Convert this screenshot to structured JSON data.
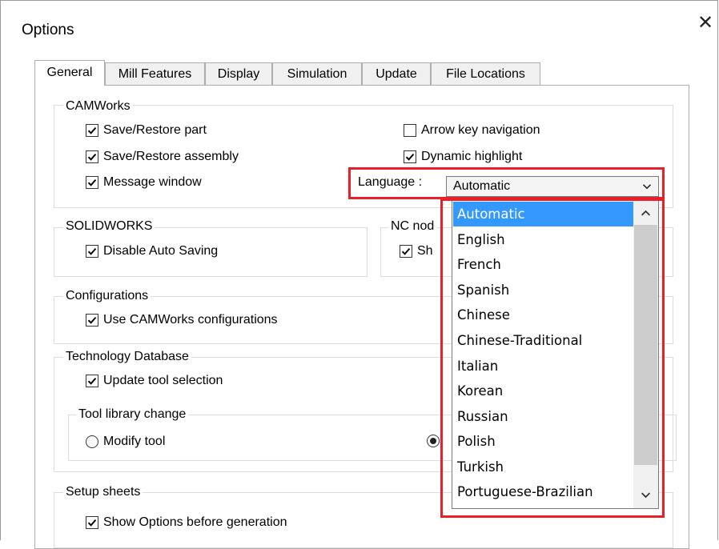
{
  "window": {
    "title": "Options",
    "close_glyph": "✕"
  },
  "tabs": [
    {
      "label": "General",
      "active": true
    },
    {
      "label": "Mill Features"
    },
    {
      "label": "Display"
    },
    {
      "label": "Simulation"
    },
    {
      "label": "Update"
    },
    {
      "label": "File Locations"
    }
  ],
  "camworks": {
    "label": "CAMWorks",
    "save_restore_part": "Save/Restore part",
    "save_restore_assembly": "Save/Restore assembly",
    "message_window": "Message window",
    "arrow_key_navigation": "Arrow key navigation",
    "dynamic_highlight": "Dynamic highlight",
    "language_label": "Language :",
    "language_value": "Automatic"
  },
  "solidworks": {
    "label": "SOLIDWORKS",
    "disable_auto_saving": "Disable Auto Saving"
  },
  "nc": {
    "label": "NC nod",
    "show_label": "Sh"
  },
  "configurations": {
    "label": "Configurations",
    "use_configs": "Use CAMWorks configurations"
  },
  "techdb": {
    "label": "Technology Database",
    "update_tool_selection": "Update tool selection",
    "tool_library_change": "Tool library change",
    "modify_tool": "Modify tool"
  },
  "setup_sheets": {
    "label": "Setup sheets",
    "show_options": "Show Options before generation"
  },
  "language_options": [
    "Automatic",
    "English",
    "French",
    "Spanish",
    "Chinese",
    "Chinese-Traditional",
    "Italian",
    "Korean",
    "Russian",
    "Polish",
    "Turkish",
    "Portuguese-Brazilian"
  ],
  "colors": {
    "highlight": "#e8202a",
    "selection": "#3399ff"
  },
  "icons": [
    "close-icon",
    "checkmark-icon",
    "chevron-down-icon",
    "chevron-up-icon"
  ]
}
